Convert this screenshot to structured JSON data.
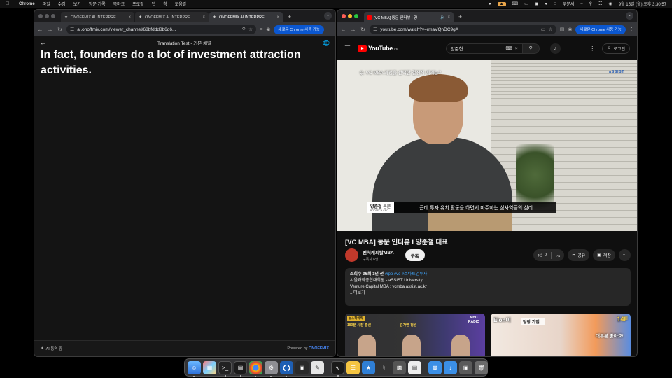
{
  "menubar": {
    "app_name": "Chrome",
    "menus": [
      "파일",
      "수정",
      "보기",
      "방문 기록",
      "북마크",
      "프로필",
      "탭",
      "창",
      "도움말"
    ],
    "status_text": "부분서",
    "clock": "9월 15일 (월) 오후 3:30:57"
  },
  "left_window": {
    "tabs": [
      {
        "title": "ONOFFMIX AI INTERPRE",
        "active": false
      },
      {
        "title": "ONOFFMIX AI INTERPRE",
        "active": false
      },
      {
        "title": "ONOFFMIX AI INTERPRE",
        "active": true
      }
    ],
    "url": "ai.onoffmix.com/viewer_channel/68bfddd8b6d6...",
    "page_title": "Translation Test - 기본 채널",
    "caption": "In fact, founders do a lot of investment attraction activities.",
    "footer_status": "AI 통역 중",
    "powered_by": "Powered by",
    "brand": "ONOFFMIX",
    "chrome_prompt": "새로운 Chrome 사용 가능"
  },
  "right_window": {
    "tab_title": "[VC MBA] 동문 인터뷰 I 양",
    "url": "youtube.com/watch?v=rmaVQnDC9gA",
    "chrome_prompt": "새로운 Chrome 사용 가능",
    "youtube": {
      "logo_text": "YouTube",
      "logo_region": "KR",
      "search_query": "양준형",
      "login_label": "로그인",
      "video_question": "Q. VC MBA 과정을 선택한 결정적 계기는?",
      "watermark": "aSSIST",
      "speaker_name": "양준철",
      "speaker_role": "동문",
      "speaker_sub": "BOOTECH CEO",
      "subtitle": "근데 투자 유치 활동을 하면서 마주하는 심사역들의 심리",
      "title": "[VC MBA] 동문 인터뷰 I 양준철 대표",
      "channel_name": "벤처캐피탈MBA",
      "subscribers": "구독자 6명",
      "subscribe_label": "구독",
      "like_count": "0",
      "share_label": "공유",
      "save_label": "저장",
      "description": {
        "meta": "조회수 96회  1년 전",
        "tags": "#ipo #vc #스타트업투자",
        "line1": "서울과학종합대학원 - aSSIST University",
        "line2": "Venture Capital MBA : vcmba.assist.ac.kr",
        "more": "...더보기"
      },
      "thumb1": {
        "badge": "뉴스하이킥",
        "line1": "180분 사장 출신",
        "line2": "김가연 정원",
        "radio_top": "MBC",
        "radio_bottom": "RADIO"
      },
      "thumb2": {
        "logo": "Elon이",
        "cap1": "당장 가입...",
        "cap2": "대부분 좋아요!",
        "badge": "14F"
      }
    }
  }
}
